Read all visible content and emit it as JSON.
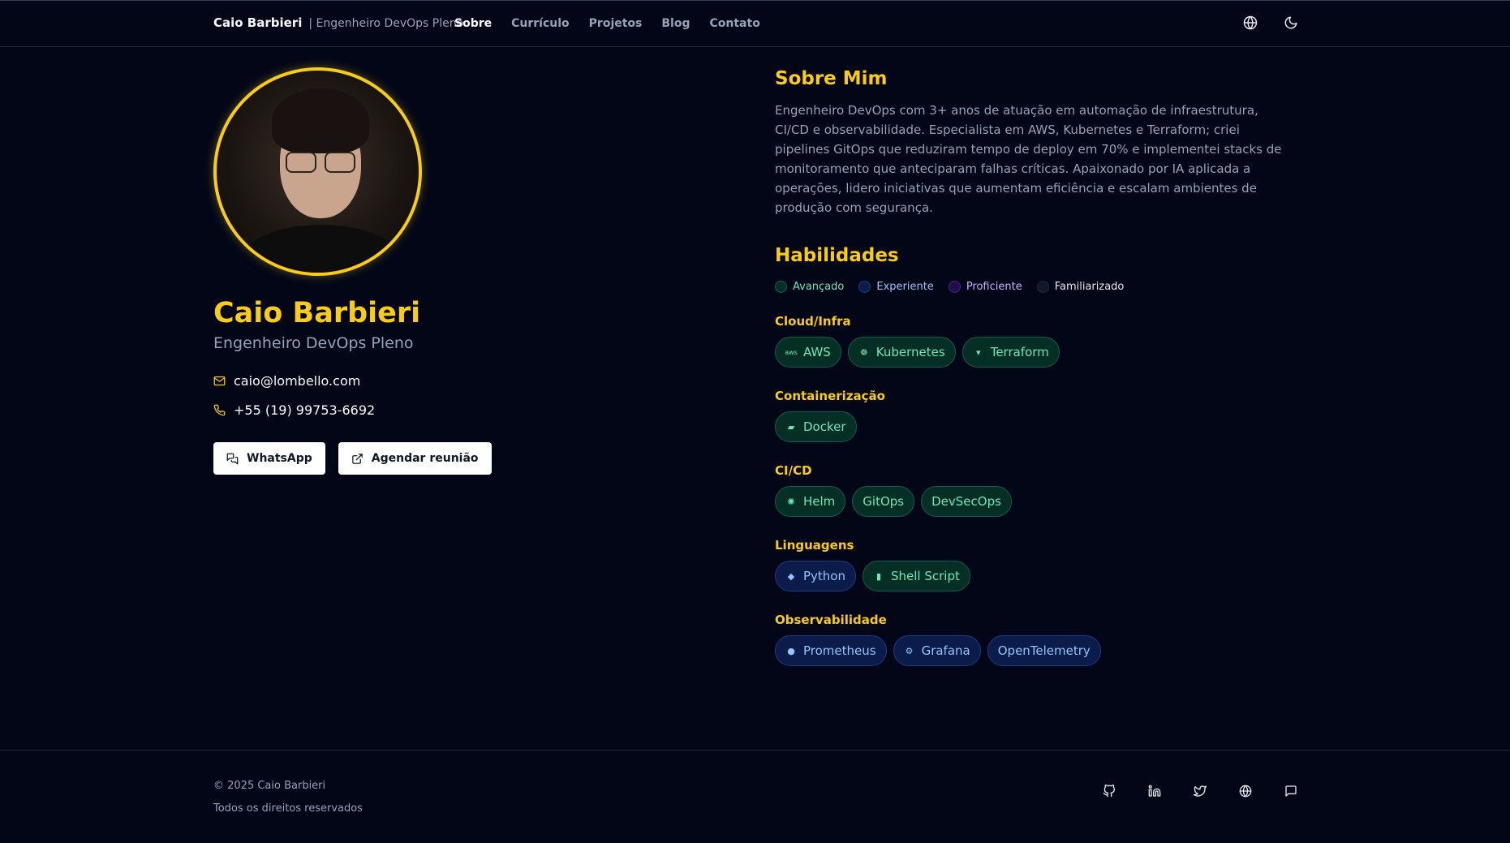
{
  "header": {
    "brand_name": "Caio Barbieri",
    "brand_role": "| Engenheiro DevOps Pleno",
    "nav": [
      "Sobre",
      "Currículo",
      "Projetos",
      "Blog",
      "Contato"
    ],
    "active_nav": "Sobre",
    "icons": [
      "globe-icon",
      "moon-icon"
    ]
  },
  "profile": {
    "name": "Caio Barbieri",
    "role": "Engenheiro DevOps Pleno",
    "email": "caio@lombello.com",
    "phone": "+55 (19) 99753-6692",
    "whatsapp_label": "WhatsApp",
    "schedule_label": "Agendar reunião"
  },
  "about": {
    "title": "Sobre Mim",
    "text": "Engenheiro DevOps com 3+ anos de atuação em automação de infraestrutura, CI/CD e observabilidade. Especialista em AWS, Kubernetes e Terraform; criei pipelines GitOps que reduziram tempo de deploy em 70% e implementei stacks de monitoramento que anteciparam falhas críticas. Apaixonado por IA aplicada a operações, lidero iniciativas que aumentam eficiência e escalam ambientes de produção com segurança."
  },
  "skills": {
    "title": "Habilidades",
    "legend": [
      {
        "label": "Avançado",
        "level": "adv",
        "color": "#6ee7b7"
      },
      {
        "label": "Experiente",
        "level": "exp",
        "color": "#93c5fd"
      },
      {
        "label": "Proficiente",
        "level": "pro",
        "color": "#c4b5fd"
      },
      {
        "label": "Familiarizado",
        "level": "fam",
        "color": "#e5e7eb"
      }
    ],
    "categories": [
      {
        "name": "Cloud/Infra",
        "items": [
          {
            "label": "AWS",
            "level": "adv",
            "icon": "aws"
          },
          {
            "label": "Kubernetes",
            "level": "adv",
            "icon": "☸"
          },
          {
            "label": "Terraform",
            "level": "adv",
            "icon": "⌁"
          }
        ]
      },
      {
        "name": "Containerização",
        "items": [
          {
            "label": "Docker",
            "level": "adv",
            "icon": "🐳"
          }
        ]
      },
      {
        "name": "CI/CD",
        "items": [
          {
            "label": "Helm",
            "level": "adv",
            "icon": "⎈"
          },
          {
            "label": "GitOps",
            "level": "adv",
            "icon": ""
          },
          {
            "label": "DevSecOps",
            "level": "adv",
            "icon": ""
          }
        ]
      },
      {
        "name": "Linguagens",
        "items": [
          {
            "label": "Python",
            "level": "exp",
            "icon": "🐍"
          },
          {
            "label": "Shell Script",
            "level": "adv",
            "icon": "▮"
          }
        ]
      },
      {
        "name": "Observabilidade",
        "items": [
          {
            "label": "Prometheus",
            "level": "exp",
            "icon": "🔥"
          },
          {
            "label": "Grafana",
            "level": "exp",
            "icon": "⚙"
          },
          {
            "label": "OpenTelemetry",
            "level": "exp",
            "icon": ""
          }
        ]
      }
    ]
  },
  "footer": {
    "copyright": "© 2025 Caio Barbieri",
    "rights": "Todos os direitos reservados",
    "social": [
      "github-icon",
      "linkedin-icon",
      "twitter-icon",
      "globe-icon",
      "message-icon"
    ]
  },
  "colors": {
    "background": "#020617",
    "accent": "#facc15",
    "muted": "#94a3b8"
  }
}
